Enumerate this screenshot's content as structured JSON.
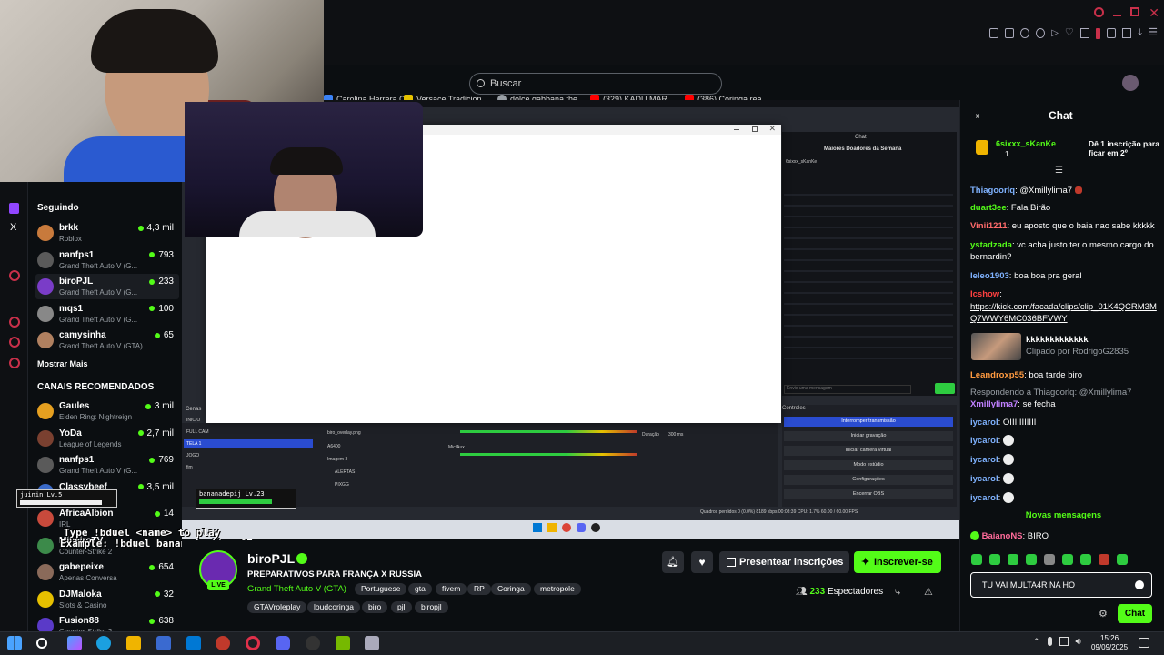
{
  "bookmarks": [
    {
      "label": "Carolina Herrera C...",
      "color": "#3b82f6"
    },
    {
      "label": "Versace Tradicion...",
      "color": "#e6c200"
    },
    {
      "label": "dolce gabbana the...",
      "color": "#9aa0a6"
    },
    {
      "label": "(329) KADU MAR...",
      "color": "#ff0000"
    },
    {
      "label": "(386) Coringa rea...",
      "color": "#ff0000"
    }
  ],
  "search": {
    "placeholder": "Buscar"
  },
  "sidebar": {
    "following_title": "Seguindo",
    "following": [
      {
        "name": "brkk",
        "game": "Roblox",
        "viewers": "4,3 mil",
        "color": "#c87a3c"
      },
      {
        "name": "nanfps1",
        "game": "Grand Theft Auto V (G...",
        "viewers": "793",
        "color": "#5a5a5a"
      },
      {
        "name": "biroPJL",
        "game": "Grand Theft Auto V (G...",
        "viewers": "233",
        "color": "#7a3cc8"
      },
      {
        "name": "mqs1",
        "game": "Grand Theft Auto V (G...",
        "viewers": "100",
        "color": "#888888"
      },
      {
        "name": "camysinha",
        "game": "Grand Theft Auto V (GTA)",
        "viewers": "65",
        "color": "#b08060"
      }
    ],
    "show_more": "Mostrar Mais",
    "recommended_title": "CANAIS RECOMENDADOS",
    "recommended": [
      {
        "name": "Gaules",
        "game": "Elden Ring: Nightreign",
        "viewers": "3 mil",
        "color": "#e6a020"
      },
      {
        "name": "YoDa",
        "game": "League of Legends",
        "viewers": "2,7 mil",
        "color": "#7a4030"
      },
      {
        "name": "nanfps1",
        "game": "Grand Theft Auto V (G...",
        "viewers": "769",
        "color": "#5a5a5a"
      },
      {
        "name": "Classybeef",
        "game": "",
        "viewers": "3,5 mil",
        "color": "#3a6ac8"
      },
      {
        "name": "AfricaAlbion",
        "game": "IRL",
        "viewers": "14",
        "color": "#c84a3c"
      },
      {
        "name": "MineiroTV",
        "game": "Counter-Strike 2",
        "viewers": "",
        "color": "#3c8a4a"
      },
      {
        "name": "gabepeixe",
        "game": "Apenas Conversa",
        "viewers": "654",
        "color": "#8a6a5a"
      },
      {
        "name": "DJMaloka",
        "game": "Slots & Casino",
        "viewers": "32",
        "color": "#e6c000"
      },
      {
        "name": "Fusion88",
        "game": "Counter-Strike 2",
        "viewers": "638",
        "color": "#5a3ac8"
      }
    ]
  },
  "overlay": {
    "duel_line1": "Type !bduel <name> to play",
    "duel_line2": "Example: !bduel bananadepijama07",
    "nameplate": "bananadepij Lv.23",
    "nameplate2": "juinin Lv.5"
  },
  "stream": {
    "channel": "biroPJL",
    "title": "PREPARATIVOS PARA FRANÇA X RUSSIA",
    "category": "Grand Theft Auto V (GTA)",
    "language": "Portuguese",
    "tags": [
      "gta",
      "fivem",
      "RP",
      "Coringa",
      "metropole"
    ],
    "tags2": [
      "GTAVroleplay",
      "loudcoringa",
      "biro",
      "pjl",
      "biropjl"
    ],
    "viewers": "233",
    "viewers_label": "Espectadores",
    "live_badge": "LIVE",
    "gift_button": "Presentear inscrições",
    "subscribe_button": "Inscrever-se"
  },
  "chat": {
    "title": "Chat",
    "pinned_user": "6sixxx_sKanKe",
    "pinned_count": "1",
    "pinned_cta": "Dê 1 inscrição para ficar em 2º",
    "messages": [
      {
        "user": "Thiagoorlq",
        "color": "#7fb2ff",
        "text": "@Xmillylima7"
      },
      {
        "user": "duart3ee",
        "color": "#53fc18",
        "text": "Fala Birão"
      },
      {
        "user": "Vinii1211",
        "color": "#ff6b6b",
        "text": "eu aposto que o baia nao sabe kkkkk"
      },
      {
        "user": "ystadzada",
        "color": "#53fc18",
        "text": "vc acha justo ter o mesmo cargo do bernardin?"
      },
      {
        "user": "leleo1903",
        "color": "#7fb2ff",
        "text": "boa boa pra geral"
      },
      {
        "user": "Icshow",
        "color": "#ff4040",
        "text": ""
      },
      {
        "user": "",
        "color": "#ffffff",
        "text": "https://kick.com/facada/clips/clip_01K4QCRM3MQ7WWY6MC036BFVWY"
      },
      {
        "user": "",
        "color": "#ffffff",
        "text": "kkkkkkkkkkkkk"
      },
      {
        "user": "",
        "color": "#9aa0a6",
        "text": "Clipado por RodrigoG2835"
      },
      {
        "user": "Leandroxp55",
        "color": "#ff9a40",
        "text": "boa tarde biro"
      },
      {
        "user": "",
        "color": "#9aa0a6",
        "text": "Respondendo a Thiagoorlq: @Xmillylima7"
      },
      {
        "user": "Xmillylima7",
        "color": "#c080ff",
        "text": "se fecha"
      },
      {
        "user": "iycaroI",
        "color": "#7fb2ff",
        "text": "OIIIIIIIIIII"
      },
      {
        "user": "iycaroI",
        "color": "#7fb2ff",
        "text": ""
      },
      {
        "user": "iycaroI",
        "color": "#7fb2ff",
        "text": ""
      },
      {
        "user": "iycaroI",
        "color": "#7fb2ff",
        "text": ""
      },
      {
        "user": "iycaroI",
        "color": "#7fb2ff",
        "text": ""
      }
    ],
    "new_messages": "Novas mensagens",
    "last_user": "BaianoNS",
    "last_text": "BIRO",
    "input_value": "TU VAI MULTA4R NA HO",
    "send_button": "Chat"
  },
  "obs": {
    "chat_title": "Chat",
    "top_donors": "Maiores Doadores da Semana",
    "scenes_header": "Cenas",
    "scenes": [
      "INICIO",
      "FULL CAM",
      "TELA 1",
      "JOGO",
      "fim"
    ],
    "sources": [
      "biro_overlay.png",
      "A6400",
      "Imagem 3",
      "ALERTAS",
      "PIXGG"
    ],
    "controls_header": "Controles",
    "controls": [
      "Interromper transmissão",
      "Iniciar gravação",
      "Iniciar câmera virtual",
      "Modo estúdio",
      "Configurações",
      "Encerrar OBS"
    ],
    "status": "Quadros perdidos 0 (0.0%)  8189 kbps  00:08:39  CPU: 1.7%  60.00 / 60.00 FPS",
    "audio_label": "Mic/Aux",
    "duration_label": "Duração",
    "duration_value": "300 ms",
    "chat_placeholder": "Envie uma mensagem"
  },
  "clock": {
    "time": "15:26",
    "date": "09/09/2025"
  }
}
